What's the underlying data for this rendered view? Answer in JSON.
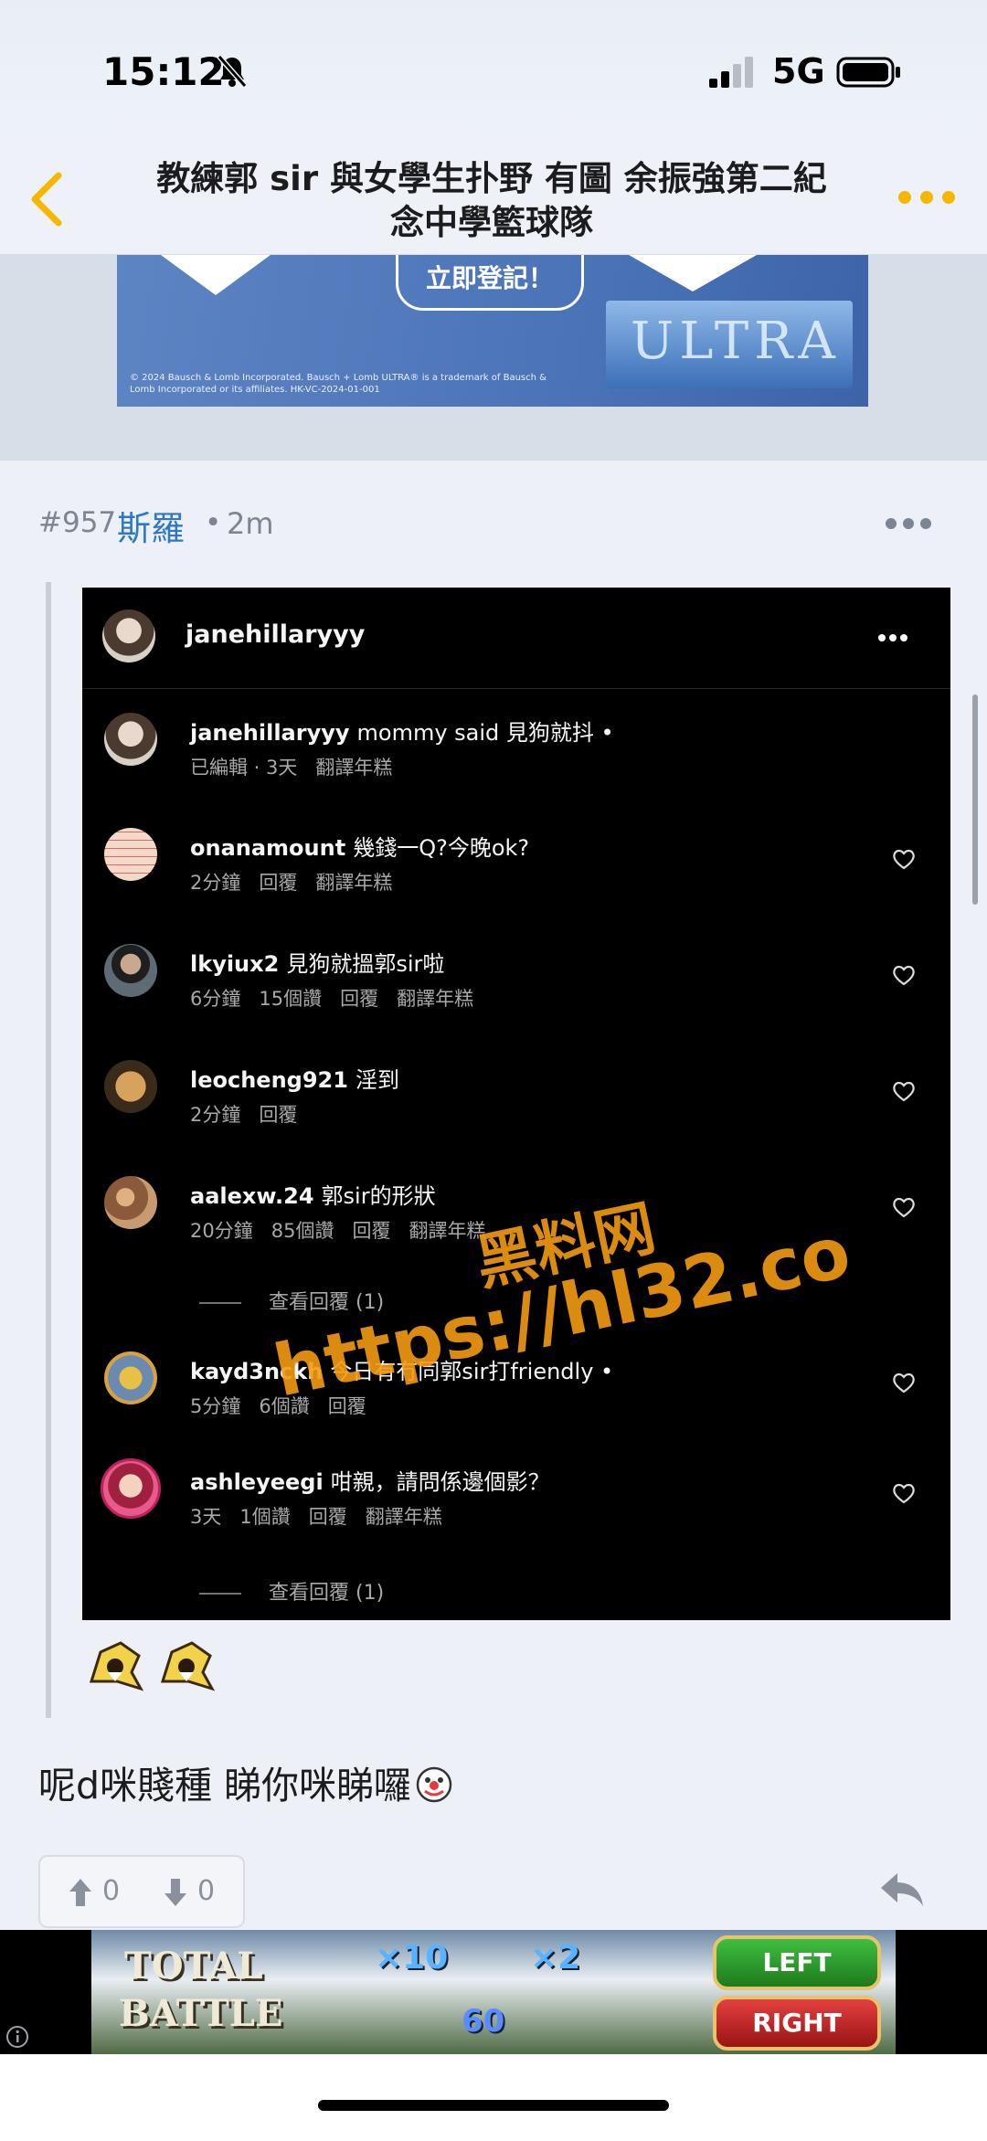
{
  "status_bar": {
    "time": "15:12",
    "network": "5G",
    "icons": [
      "bell-slash-icon",
      "signal-icon",
      "battery-icon"
    ]
  },
  "nav": {
    "title_line1": "教練郭 sir 與女學生扑野 有圖 余振強第二紀",
    "title_line2": "念中學籃球隊",
    "accent_color": "#f5b700",
    "icons": [
      "back-chevron-icon",
      "more-dots-icon"
    ]
  },
  "ad_top": {
    "cta": "立即登記！",
    "brand": "ULTRA",
    "legal_line1": "© 2024 Bausch & Lomb Incorporated. Bausch + Lomb ULTRA® is a trademark of Bausch &",
    "legal_line2": "Lomb Incorporated or its affiliates. HK-VC-2024-01-001"
  },
  "post": {
    "floor": "#957",
    "author": "斯羅",
    "separator": "•",
    "age": "2m",
    "body": "呢d咪賤種 睇你咪睇囉",
    "upvotes": "0",
    "downvotes": "0",
    "author_color": "#2f78c4"
  },
  "instagram": {
    "header_user": "janehillaryyy",
    "comments": [
      {
        "user": "janehillaryyy",
        "text": "mommy said 見狗就抖 •",
        "meta": [
          "已編輯 · 3天",
          "翻譯年糕"
        ],
        "heart": false
      },
      {
        "user": "onanamount",
        "text": "幾錢一Q?今晚ok?",
        "meta": [
          "2分鐘",
          "回覆",
          "翻譯年糕"
        ],
        "heart": true
      },
      {
        "user": "lkyiux2",
        "text": "見狗就搵郭sir啦",
        "meta": [
          "6分鐘",
          "15個讚",
          "回覆",
          "翻譯年糕"
        ],
        "heart": true
      },
      {
        "user": "leocheng921",
        "text": "淫到",
        "meta": [
          "2分鐘",
          "回覆"
        ],
        "heart": true
      },
      {
        "user": "aalexw.24",
        "text": "郭sir的形狀",
        "meta": [
          "20分鐘",
          "85個讚",
          "回覆",
          "翻譯年糕"
        ],
        "heart": true
      },
      {
        "user": "kayd3nckh",
        "text": "今日有冇同郭sir打friendly •",
        "meta": [
          "5分鐘",
          "6個讚",
          "回覆"
        ],
        "heart": true
      },
      {
        "user": "ashleyeegi",
        "text": "咁親，請問係邊個影？",
        "meta": [
          "3天",
          "1個讚",
          "回覆",
          "翻譯年糕"
        ],
        "heart": true
      }
    ],
    "view_replies_1": "查看回覆 (1)",
    "view_replies_2": "查看回覆 (1)"
  },
  "watermark": {
    "line1": "黑料网",
    "line2": "https://hl32.co"
  },
  "ad_bottom": {
    "line1": "TOTAL",
    "line2": "BATTLE",
    "mult1": "×10",
    "mult2": "×2",
    "count": "60",
    "left_btn": "LEFT",
    "right_btn": "RIGHT"
  }
}
